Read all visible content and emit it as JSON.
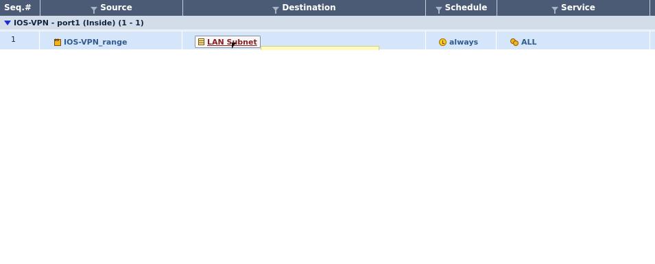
{
  "columns": {
    "seq": "Seq.#",
    "source": "Source",
    "destination": "Destination",
    "schedule": "Schedule",
    "service": "Service"
  },
  "group": {
    "label": "IOS-VPN - port1 (Inside) (1 - 1)"
  },
  "rows": [
    {
      "seq": "1",
      "source": "IOS-VPN_range",
      "destination": "LAN Subnet",
      "schedule": "always",
      "service": "ALL"
    }
  ],
  "icons": {
    "filter": "funnel-icon",
    "expand": "triangle-down-icon",
    "source": "address-range-icon",
    "destination": "address-group-icon",
    "schedule": "clock-icon",
    "service": "service-icon"
  },
  "colors": {
    "header_bg": "#4b5a75",
    "group_bg": "#d2dde9",
    "row_bg": "#d6e6fa",
    "link_text": "#8b1d1d",
    "tooltip_bg": "#fffbbf"
  }
}
